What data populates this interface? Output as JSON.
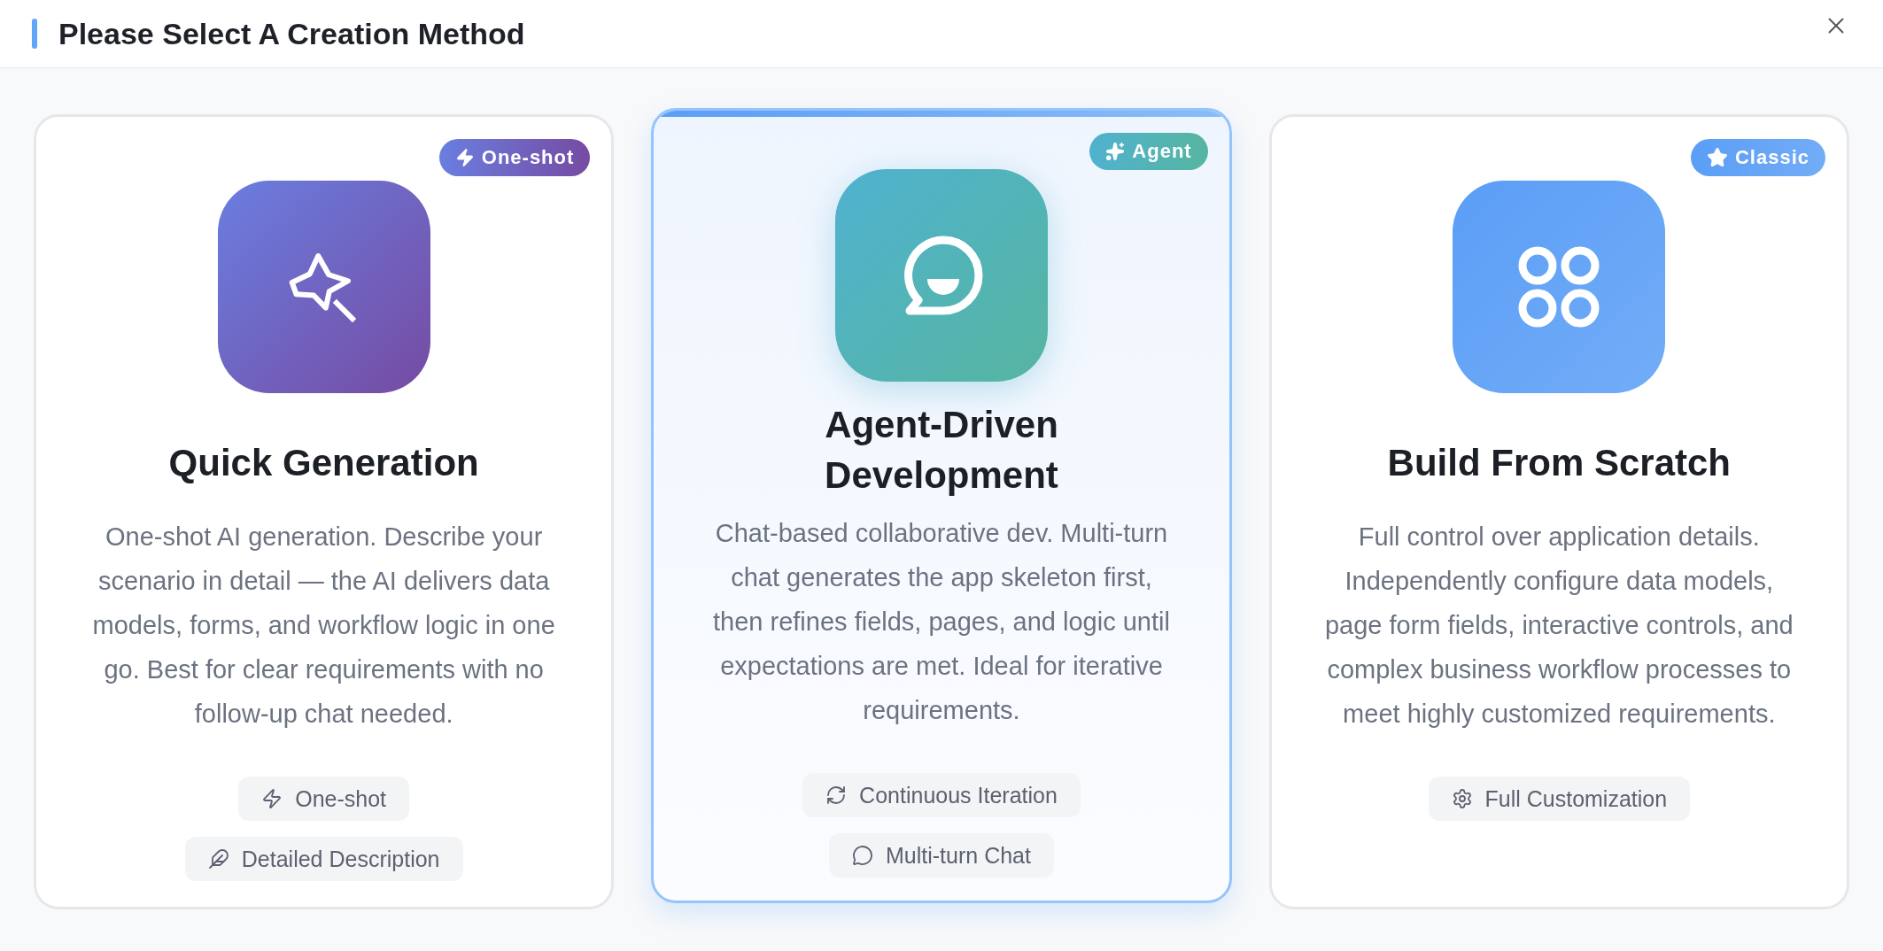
{
  "dialog": {
    "title": "Please Select A Creation Method"
  },
  "cards": [
    {
      "kind": "quick",
      "selected": false,
      "badge": "One-shot",
      "title": "Quick Generation",
      "description": "One-shot AI generation. Describe your scenario in detail — the AI delivers data models, forms, and workflow logic in one go. Best for clear requirements with no follow-up chat needed.",
      "chips": [
        "One-shot",
        "Detailed Description"
      ]
    },
    {
      "kind": "agent",
      "selected": true,
      "badge": "Agent",
      "title": "Agent-Driven Development",
      "description": "Chat-based collaborative dev. Multi-turn chat generates the app skeleton first, then refines fields, pages, and logic until expectations are met. Ideal for iterative requirements.",
      "chips": [
        "Continuous Iteration",
        "Multi-turn Chat"
      ]
    },
    {
      "kind": "scratch",
      "selected": false,
      "badge": "Classic",
      "title": "Build From Scratch",
      "description": "Full control over application details. Independently configure data models, page form fields, interactive controls, and complex business workflow processes to meet highly customized requirements.",
      "chips": [
        "Full Customization"
      ]
    }
  ]
}
